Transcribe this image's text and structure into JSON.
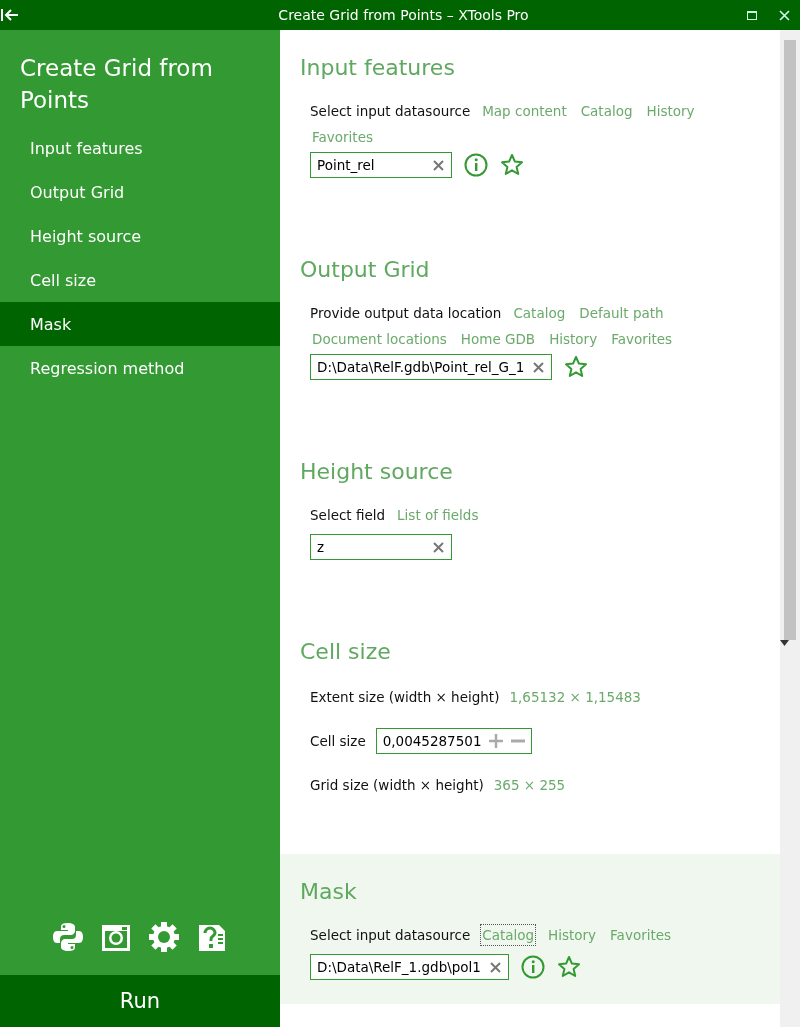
{
  "window": {
    "title": "Create Grid from Points – XTools Pro"
  },
  "sidebar": {
    "title": "Create Grid from Points",
    "items": [
      {
        "label": "Input features",
        "selected": false
      },
      {
        "label": "Output Grid",
        "selected": false
      },
      {
        "label": "Height source",
        "selected": false
      },
      {
        "label": "Cell size",
        "selected": false
      },
      {
        "label": "Mask",
        "selected": true
      },
      {
        "label": "Regression method",
        "selected": false
      }
    ],
    "run_button": "Run"
  },
  "sections": [
    {
      "title": "Input features",
      "active": false,
      "rows": [
        {
          "kind": "links",
          "label": "Select input datasource",
          "links": [
            {
              "label": "Map content",
              "focused": false
            },
            {
              "label": "Catalog",
              "focused": false
            },
            {
              "label": "History",
              "focused": false
            },
            {
              "label": "Favorites",
              "focused": false
            }
          ]
        },
        {
          "kind": "field",
          "value": "Point_rel",
          "info": true,
          "favorite": true
        }
      ]
    },
    {
      "title": "Output Grid",
      "active": false,
      "rows": [
        {
          "kind": "links",
          "label": "Provide output data location",
          "links": [
            {
              "label": "Catalog",
              "focused": false
            },
            {
              "label": "Default path",
              "focused": false
            },
            {
              "label": "Document locations",
              "focused": false
            },
            {
              "label": "Home GDB",
              "focused": false
            },
            {
              "label": "History",
              "focused": false
            },
            {
              "label": "Favorites",
              "focused": false
            }
          ]
        },
        {
          "kind": "field",
          "value": "D:\\Data\\RelF.gdb\\Point_rel_G_1",
          "info": false,
          "favorite": true
        }
      ]
    },
    {
      "title": "Height source",
      "active": false,
      "rows": [
        {
          "kind": "links",
          "label": "Select field",
          "links": [
            {
              "label": "List of fields",
              "focused": false
            }
          ]
        },
        {
          "kind": "field",
          "value": "z",
          "info": false,
          "favorite": false
        }
      ]
    },
    {
      "title": "Cell size",
      "active": false,
      "rows": [
        {
          "kind": "value",
          "label": "Extent size (width × height)",
          "value": "1,65132 × 1,15483"
        },
        {
          "kind": "spin",
          "label": "Cell size",
          "value": "0,0045287501"
        },
        {
          "kind": "value",
          "label": "Grid size (width × height)",
          "value": "365 × 255"
        }
      ]
    },
    {
      "title": "Mask",
      "active": true,
      "rows": [
        {
          "kind": "links",
          "label": "Select input datasource",
          "links": [
            {
              "label": "Catalog",
              "focused": true
            },
            {
              "label": "History",
              "focused": false
            },
            {
              "label": "Favorites",
              "focused": false
            }
          ]
        },
        {
          "kind": "field",
          "value": "D:\\Data\\RelF_1.gdb\\pol1",
          "info": true,
          "favorite": true
        }
      ]
    }
  ]
}
